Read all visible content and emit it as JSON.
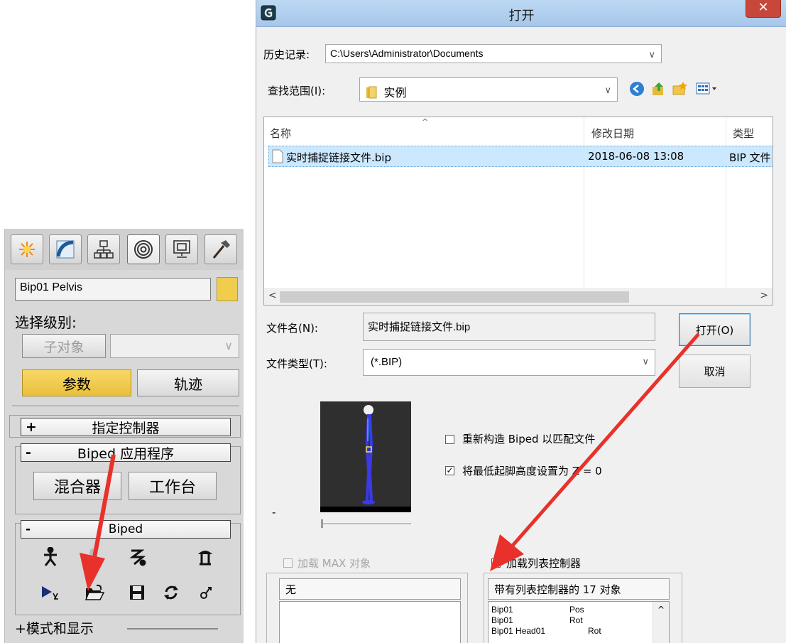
{
  "command_panel": {
    "tabs": [
      {
        "icon": "create-star-icon"
      },
      {
        "icon": "modify-curve-icon"
      },
      {
        "icon": "hierarchy-icon"
      },
      {
        "icon": "motion-icon",
        "active": true
      },
      {
        "icon": "display-monitor-icon"
      },
      {
        "icon": "utilities-hammer-icon"
      }
    ],
    "object_name": "Bip01 Pelvis",
    "object_color": "#f1cd4e",
    "selection_level_label": "选择级别:",
    "subobject_button": "子对象",
    "params_button": "参数",
    "trajectory_button": "轨迹",
    "rollout_assign_sign": "+",
    "rollout_assign": "指定控制器",
    "rollout_biped_apps_sign": "-",
    "rollout_biped_apps": "Biped 应用程序",
    "mixer_button": "混合器",
    "workbench_button": "工作台",
    "rollout_biped_sign": "-",
    "rollout_biped": "Biped",
    "biped_tools_row1": [
      "figure-mode-icon",
      "footstep-mode-icon",
      "motion-flow-icon",
      "mixer-mode-icon"
    ],
    "biped_tools_row2": [
      "playback-icon",
      "load-file-icon",
      "save-file-icon",
      "convert-icon",
      "move-all-icon"
    ],
    "mode_display": "+模式和显示"
  },
  "open_dialog": {
    "title": "打开",
    "close_glyph": "✕",
    "history_label": "历史记录:",
    "history_value": "C:\\Users\\Administrator\\Documents",
    "look_in_label": "查找范围(I):",
    "look_in_value": "实例",
    "columns": [
      "名称",
      "修改日期",
      "类型"
    ],
    "files": [
      {
        "name": "实时捕捉链接文件.bip",
        "date": "2018-06-08 13:08",
        "type": "BIP 文件"
      }
    ],
    "filename_label": "文件名(N):",
    "filename_value": "实时捕捉链接文件.bip",
    "filetype_label": "文件类型(T):",
    "filetype_value": "(*.BIP)",
    "open_button": "打开(O)",
    "cancel_button": "取消",
    "preview_dash": "-",
    "option_restructure": {
      "label": "重新构造 Biped 以匹配文件",
      "checked": false
    },
    "option_lowest_foot": {
      "label": "将最低起脚高度设置为 Z = 0",
      "checked": true
    },
    "load_max_objects": {
      "label": "加载 MAX 对象",
      "checked": false,
      "enabled": false
    },
    "load_list_controllers": {
      "label": "加载列表控制器",
      "checked": true
    },
    "max_objects_header": "无",
    "list_controllers_header": "带有列表控制器的 17 对象",
    "list_controller_items": [
      {
        "name": "Bip01",
        "ctrl": "Pos"
      },
      {
        "name": "Bip01",
        "ctrl": "Rot"
      },
      {
        "name": "Bip01 Head01",
        "ctrl": "Rot"
      }
    ]
  },
  "annotation_color": "#e8312a"
}
